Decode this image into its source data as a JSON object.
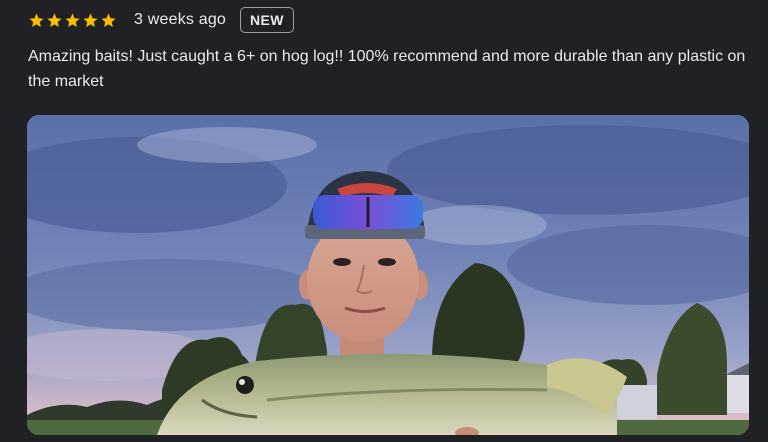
{
  "review": {
    "rating": 5,
    "star_color": "#fbbc04",
    "time_ago": "3 weeks ago",
    "badge": "NEW",
    "text": "Amazing baits! Just caught a 6+ on hog log!! 100% recommend and more durable than any plastic on the market"
  },
  "photo": {
    "icon": "review-photo"
  }
}
